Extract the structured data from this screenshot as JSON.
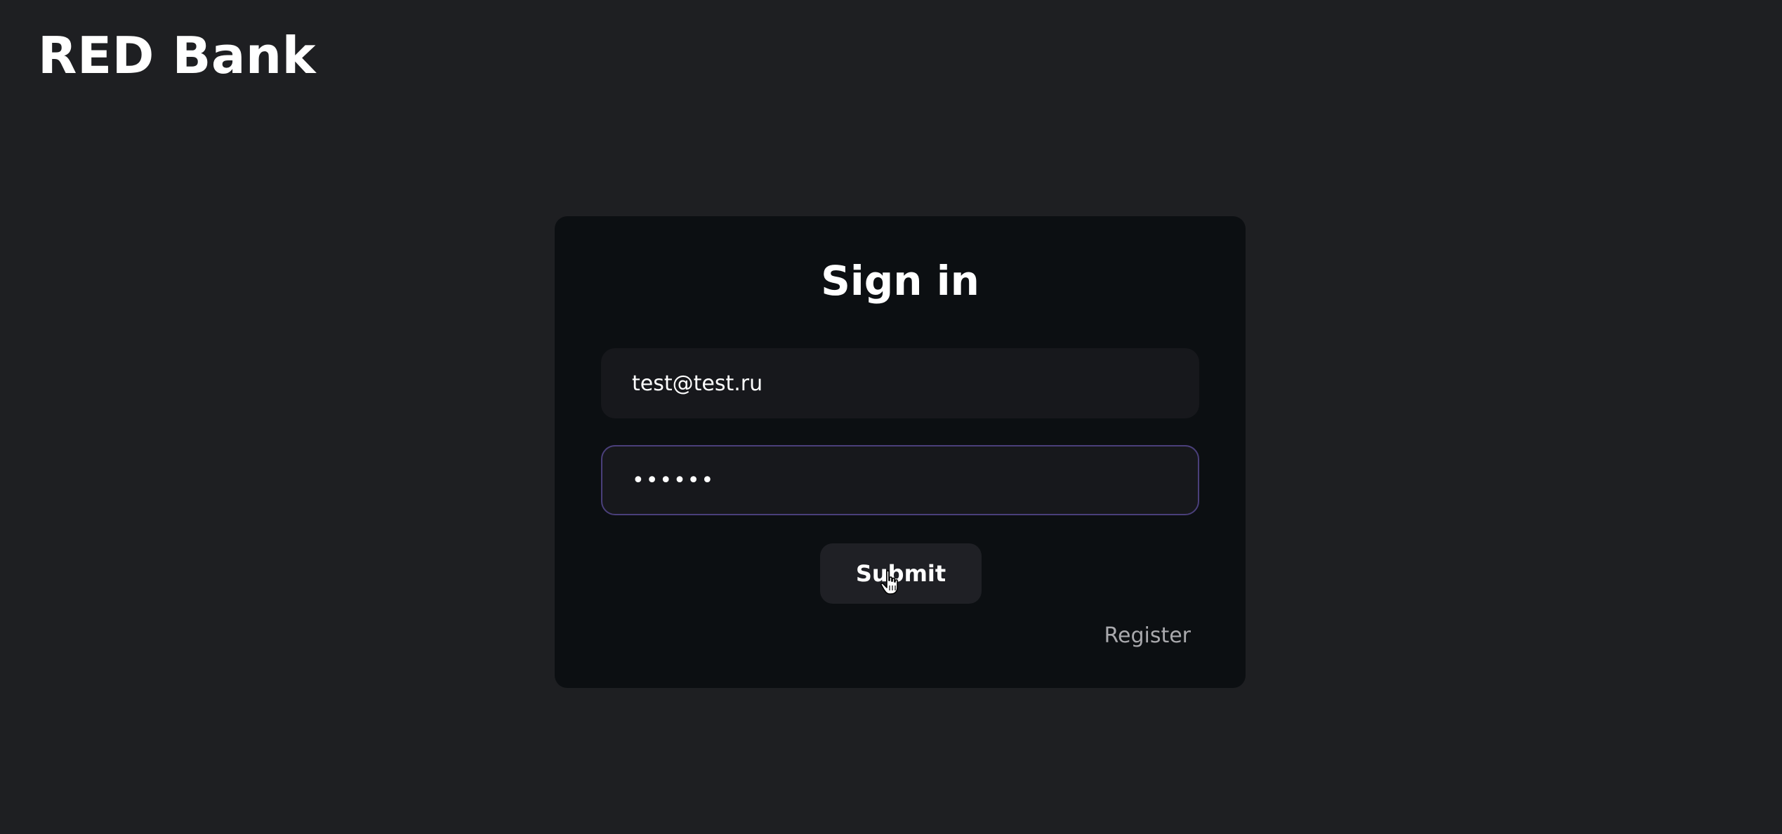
{
  "header": {
    "app_title": "RED Bank"
  },
  "signin": {
    "title": "Sign in",
    "email_value": "test@test.ru",
    "password_value": "••••••",
    "submit_label": "Submit",
    "register_label": "Register"
  },
  "colors": {
    "page_background": "#1e1f22",
    "card_background": "#0c0f12",
    "input_background": "#17181c",
    "focus_border": "#4a3f7a",
    "button_background": "#1f2025",
    "link_text": "#a9a9ad"
  },
  "icons": {
    "cursor": "hand-pointer-icon"
  }
}
